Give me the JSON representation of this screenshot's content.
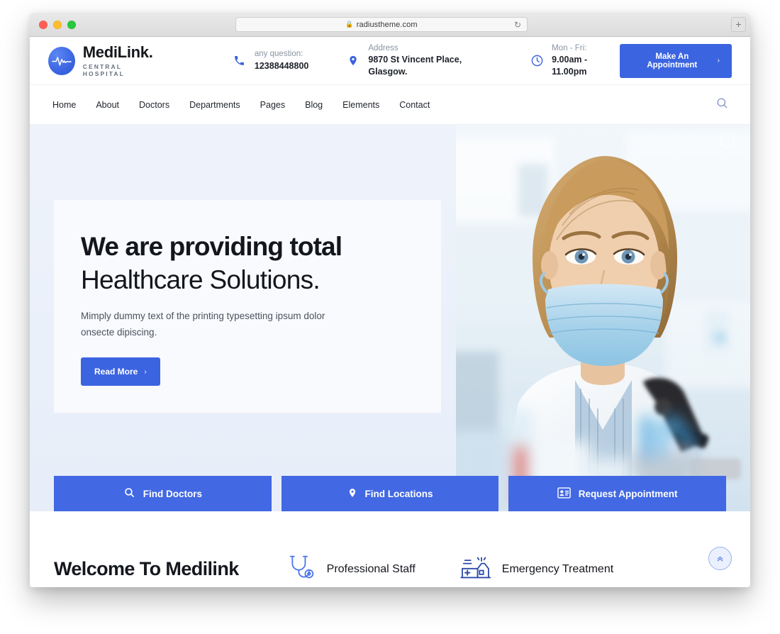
{
  "browser": {
    "url": "radiustheme.com",
    "lock_icon": "lock-icon",
    "reload_icon": "reload-icon",
    "newtab_label": "+"
  },
  "header": {
    "brand": {
      "name": "MediLink.",
      "tagline": "CENTRAL HOSPITAL",
      "logo_icon": "heartbeat-logo-icon"
    },
    "info": [
      {
        "icon": "phone-icon",
        "label": "any question:",
        "value": "12388448800"
      },
      {
        "icon": "map-pin-icon",
        "label": "Address",
        "value": "9870 St Vincent Place, Glasgow."
      },
      {
        "icon": "clock-icon",
        "label": "Mon - Fri:",
        "value": "9.00am - 11.00pm"
      }
    ],
    "appointment_button": {
      "label": "Make An Appointment",
      "chevron": "›"
    }
  },
  "nav": {
    "items": [
      "Home",
      "About",
      "Doctors",
      "Departments",
      "Pages",
      "Blog",
      "Elements",
      "Contact"
    ],
    "search_icon": "search-icon"
  },
  "hero": {
    "heading_bold": "We are providing total",
    "heading_light": "Healthcare Solutions.",
    "paragraph": "Mimply dummy text of the printing typesetting ipsum dolor onsecte dipiscing.",
    "read_more": {
      "label": "Read More",
      "chevron": "›"
    },
    "cta": [
      {
        "icon": "search-icon",
        "label": "Find Doctors"
      },
      {
        "icon": "map-pin-icon",
        "label": "Find Locations"
      },
      {
        "icon": "id-card-icon",
        "label": "Request Appointment"
      }
    ]
  },
  "welcome": {
    "title": "Welcome To Medilink",
    "features": [
      {
        "icon": "stethoscope-icon",
        "label": "Professional Staff"
      },
      {
        "icon": "ambulance-icon",
        "label": "Emergency Treatment"
      }
    ],
    "scroll_top_icon": "chevron-double-up-icon"
  },
  "colors": {
    "primary_blue": "#3b64e0",
    "cta_blue": "#4268e3",
    "hero_bg": "#eaf1fb",
    "text_dark": "#14171d",
    "text_muted": "#8a94a3"
  }
}
